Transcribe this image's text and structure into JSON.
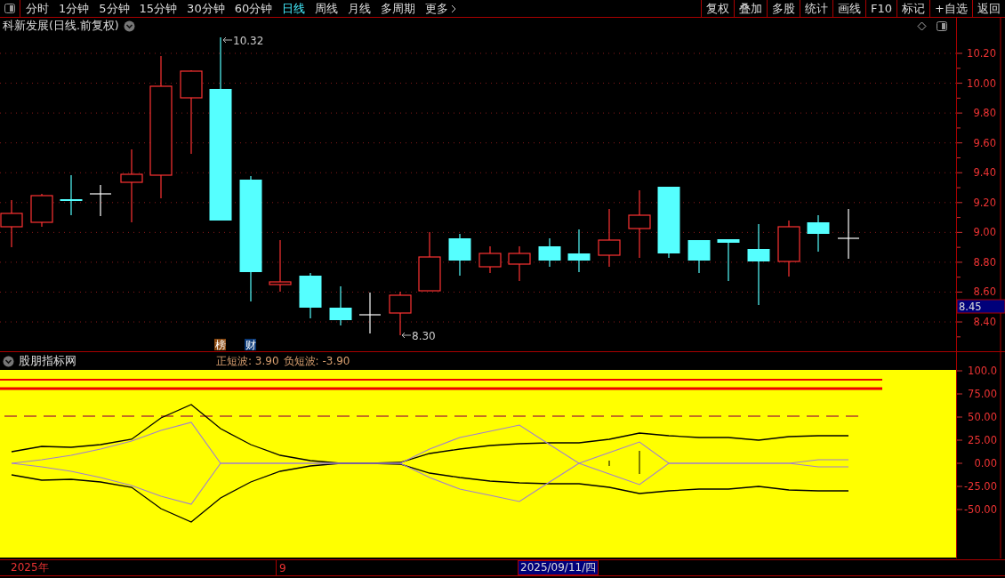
{
  "toolbar": {
    "periods": [
      {
        "label": "分时",
        "selected": false
      },
      {
        "label": "1分钟",
        "selected": false
      },
      {
        "label": "5分钟",
        "selected": false
      },
      {
        "label": "15分钟",
        "selected": false
      },
      {
        "label": "30分钟",
        "selected": false
      },
      {
        "label": "60分钟",
        "selected": false
      },
      {
        "label": "日线",
        "selected": true
      },
      {
        "label": "周线",
        "selected": false
      },
      {
        "label": "月线",
        "selected": false
      },
      {
        "label": "多周期",
        "selected": false
      },
      {
        "label": "更多",
        "selected": false
      }
    ],
    "actions": [
      "复权",
      "叠加",
      "多股",
      "统计",
      "画线",
      "F10",
      "标记",
      "+自选",
      "返回"
    ]
  },
  "chart": {
    "title": "科新发展(日线.前复权)",
    "high_label": "10.32",
    "low_label": "8.30",
    "badges": [
      {
        "label": "榜",
        "color": "#8a4a12"
      },
      {
        "label": "财",
        "color": "#0c3a78"
      }
    ],
    "price_ticks": [
      "10.20",
      "10.00",
      "9.80",
      "9.60",
      "9.40",
      "9.20",
      "9.00",
      "8.80",
      "8.60",
      "8.40"
    ],
    "current_price": "8.45"
  },
  "indicator": {
    "name": "股朋指标网",
    "readouts": [
      "正短波: 3.90",
      "负短波: -3.90"
    ],
    "ticks": [
      "100.0",
      "75.00",
      "50.00",
      "25.00",
      "0.00",
      "-25.00",
      "-50.00"
    ]
  },
  "date_bar": {
    "year": "2025年",
    "month": "9",
    "cursor_date": "2025/09/11/四"
  }
}
